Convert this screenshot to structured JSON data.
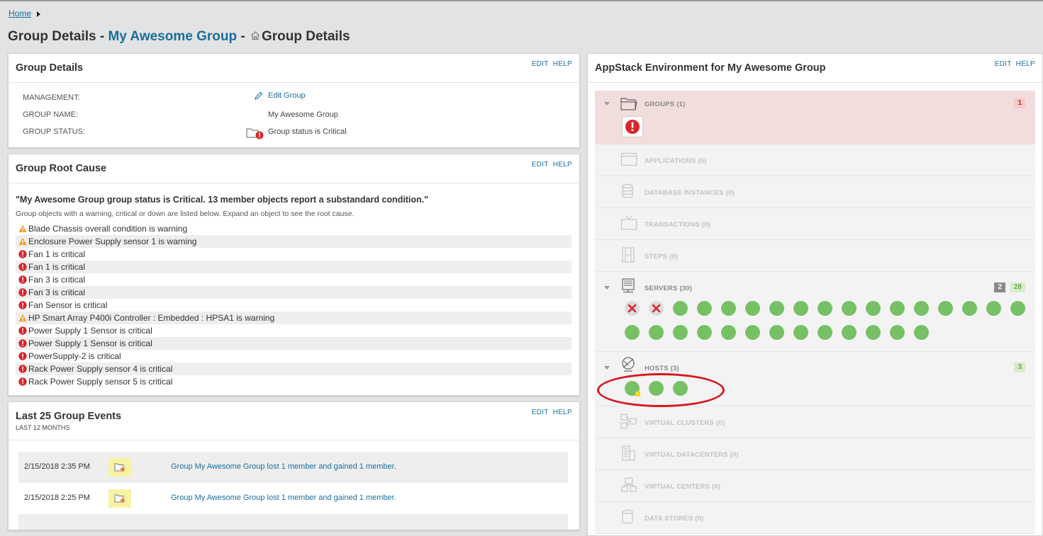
{
  "breadcrumb": {
    "home": "Home"
  },
  "title": {
    "prefix": "Group Details - ",
    "group_name": "My Awesome Group",
    "separator": " - ",
    "suffix": "Group Details"
  },
  "panel_actions": {
    "edit": "EDIT",
    "help": "HELP"
  },
  "group_details": {
    "title": "Group Details",
    "rows": [
      {
        "label": "MANAGEMENT:",
        "value": "Edit Group"
      },
      {
        "label": "GROUP NAME:",
        "value": "My Awesome Group"
      },
      {
        "label": "GROUP STATUS:",
        "value": "Group status is Critical"
      }
    ]
  },
  "root_cause": {
    "title": "Group Root Cause",
    "quote": "\"My Awesome Group group status is Critical. 13 member objects report a substandard condition.\"",
    "description": "Group objects with a warning, critical or down are listed below. Expand an object to see the root cause.",
    "items": [
      {
        "status": "warning",
        "text": "Blade Chassis overall condition is warning"
      },
      {
        "status": "warning",
        "text": "Enclosure Power Supply sensor 1 is warning"
      },
      {
        "status": "critical",
        "text": "Fan 1 is critical"
      },
      {
        "status": "critical",
        "text": "Fan 1 is critical"
      },
      {
        "status": "critical",
        "text": "Fan 3 is critical"
      },
      {
        "status": "critical",
        "text": "Fan 3 is critical"
      },
      {
        "status": "critical",
        "text": "Fan Sensor is critical"
      },
      {
        "status": "warning",
        "text": "HP Smart Array P400i Controller : Embedded : HPSA1 is warning"
      },
      {
        "status": "critical",
        "text": "Power Supply 1 Sensor is critical"
      },
      {
        "status": "critical",
        "text": "Power Supply 1 Sensor is critical"
      },
      {
        "status": "critical",
        "text": "PowerSupply-2 is critical"
      },
      {
        "status": "critical",
        "text": "Rack Power Supply sensor 4 is critical"
      },
      {
        "status": "critical",
        "text": "Rack Power Supply sensor 5 is critical"
      }
    ]
  },
  "events": {
    "title": "Last 25 Group Events",
    "subtitle": "LAST 12 MONTHS",
    "rows": [
      {
        "date": "2/15/2018 2:35 PM",
        "message": "Group My Awesome Group lost 1 member and gained 1 member."
      },
      {
        "date": "2/15/2018 2:25 PM",
        "message": "Group My Awesome Group lost 1 member and gained 1 member."
      }
    ]
  },
  "appstack": {
    "title": "AppStack Environment for My Awesome Group",
    "sections": {
      "groups": {
        "label": "GROUPS (1)",
        "badge_critical": "1"
      },
      "applications": {
        "label": "APPLICATIONS (0)"
      },
      "database_instances": {
        "label": "DATABASE INSTANCES (0)"
      },
      "transactions": {
        "label": "TRANSACTIONS (0)"
      },
      "steps": {
        "label": "STEPS (0)"
      },
      "servers": {
        "label": "SERVERS (30)",
        "badge_down": "2",
        "badge_up": "28",
        "down_count": 2,
        "up_count": 28
      },
      "hosts": {
        "label": "HOSTS (3)",
        "badge_up": "3",
        "up_count": 3,
        "warning_flag_on_first": true
      },
      "virtual_clusters": {
        "label": "VIRTUAL CLUSTERS (0)"
      },
      "virtual_datacenters": {
        "label": "VIRTUAL DATACENTERS (0)"
      },
      "virtual_centers": {
        "label": "VIRTUAL CENTERS (0)"
      },
      "data_stores": {
        "label": "DATA STORES (0)"
      }
    }
  },
  "colors": {
    "link": "#1a6e9a",
    "status_up": "#78c065",
    "status_critical": "#d9262c",
    "status_warning": "#f0a01e",
    "annotation": "#d7161e"
  }
}
